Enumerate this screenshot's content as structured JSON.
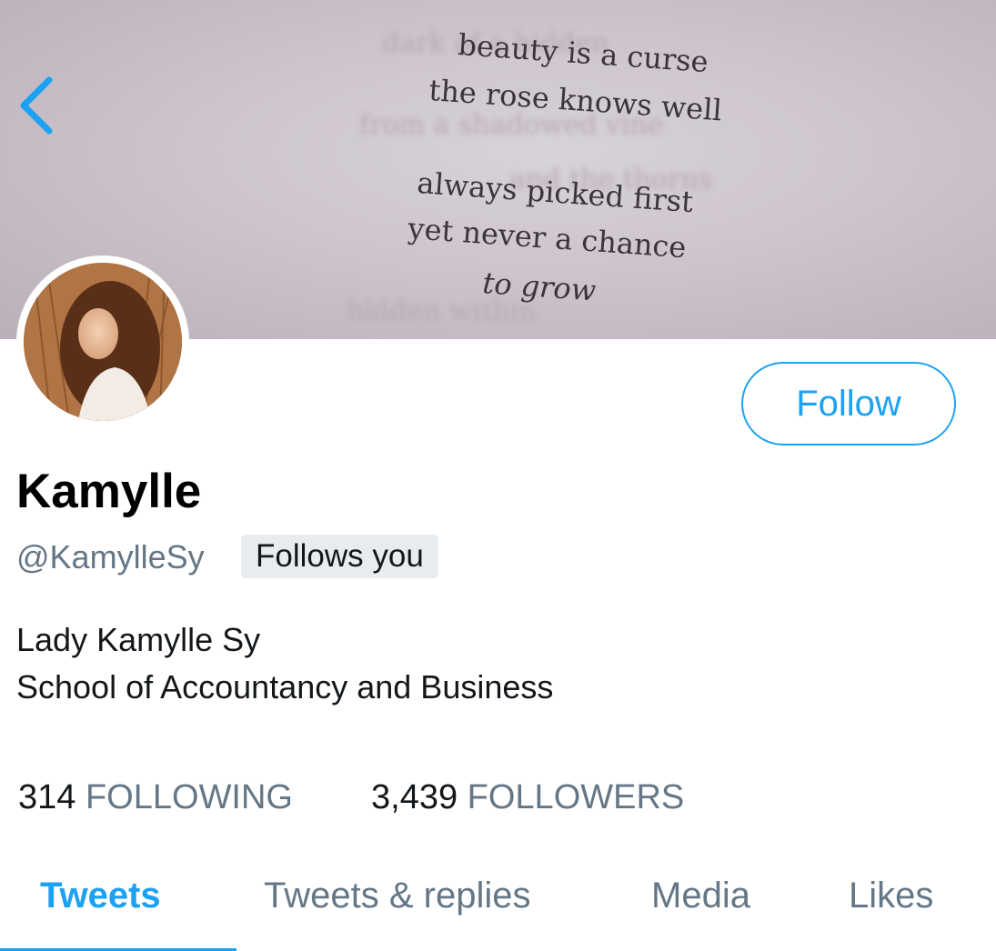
{
  "banner": {
    "poem_lines": [
      "beauty is a curse",
      "the rose knows well",
      "always picked first",
      "yet never a chance",
      "to grow"
    ]
  },
  "icons": {
    "back": "chevron-left-icon",
    "avatar": "profile-photo"
  },
  "profile": {
    "name": "Kamylle",
    "handle": "@KamylleSy",
    "follows_you": "Follows you",
    "bio_lines": [
      "Lady Kamylle Sy",
      "School of Accountancy and Business"
    ]
  },
  "actions": {
    "follow_label": "Follow"
  },
  "stats": {
    "following_count": "314",
    "following_label": "FOLLOWING",
    "followers_count": "3,439",
    "followers_label": "FOLLOWERS"
  },
  "tabs": [
    {
      "label": "Tweets",
      "active": true
    },
    {
      "label": "Tweets & replies",
      "active": false
    },
    {
      "label": "Media",
      "active": false
    },
    {
      "label": "Likes",
      "active": false
    }
  ],
  "colors": {
    "accent": "#1da1f2",
    "secondary_text": "#657786",
    "badge_bg": "#e6ecf0"
  }
}
